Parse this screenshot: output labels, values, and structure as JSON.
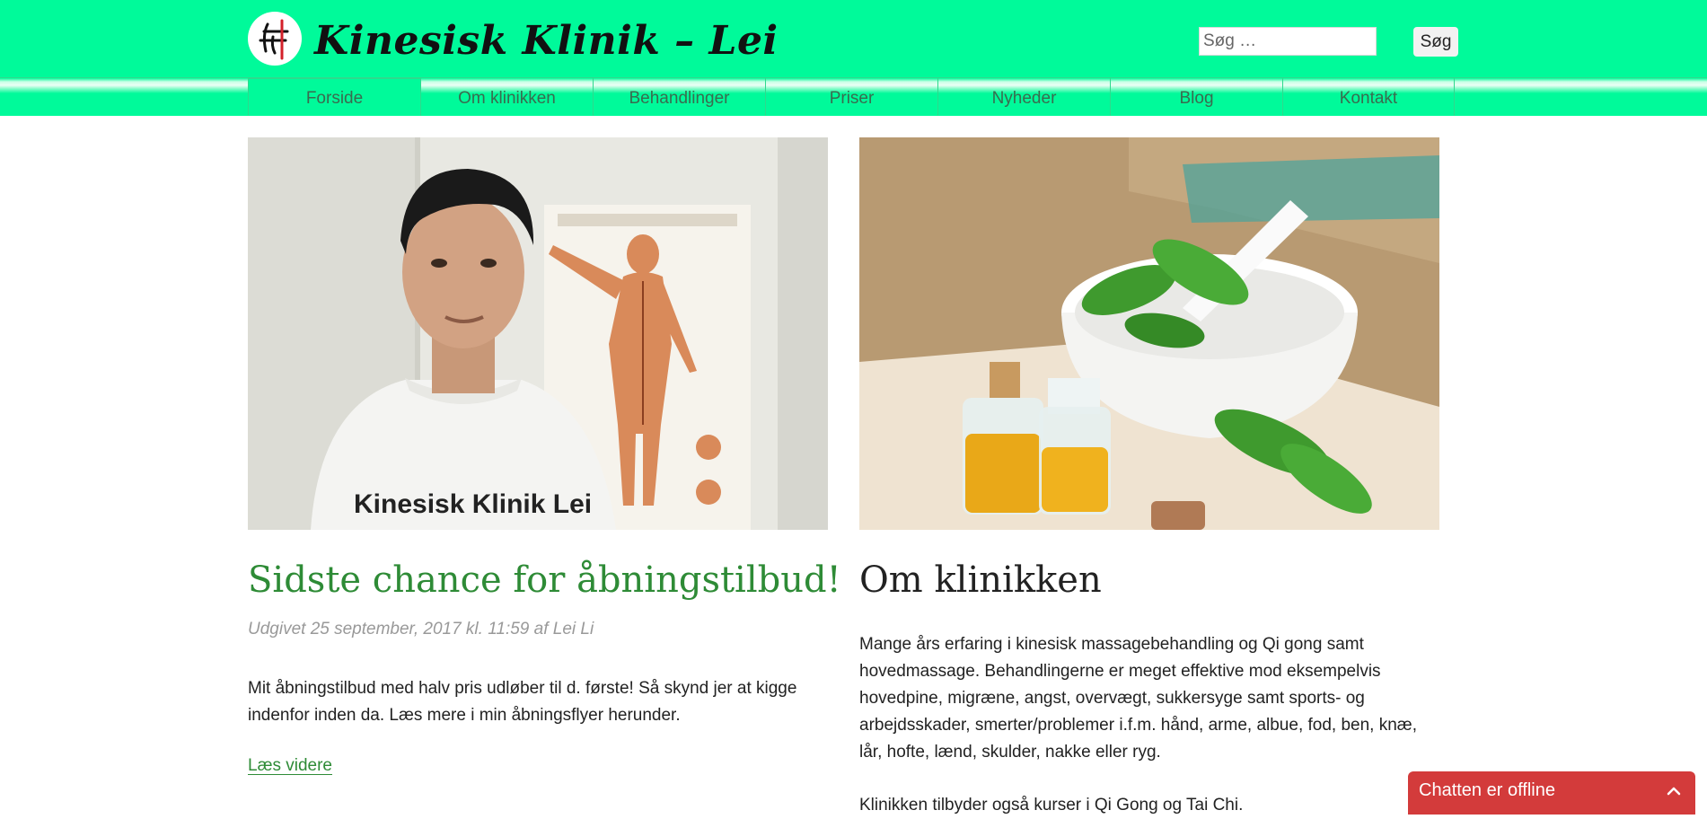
{
  "site": {
    "title": "Kinesisk Klinik – Lei",
    "logo_icon": "acupuncture-needle-logo-icon",
    "brand_color": "#00fa9a"
  },
  "search": {
    "placeholder": "Søg …",
    "button_label": "Søg"
  },
  "nav": {
    "items": [
      {
        "label": "Forside",
        "active": true
      },
      {
        "label": "Om klinikken"
      },
      {
        "label": "Behandlinger"
      },
      {
        "label": "Priser"
      },
      {
        "label": "Nyheder"
      },
      {
        "label": "Blog"
      },
      {
        "label": "Kontakt"
      }
    ]
  },
  "post": {
    "image_alt": "Man in Kinesisk Klinik Lei t-shirt beside acupuncture chart",
    "shirt_text": "Kinesisk Klinik Lei",
    "title": "Sidste chance for åbningstilbud!",
    "meta": "Udgivet 25 september, 2017 kl. 11:59 af Lei Li",
    "text": "Mit åbningstilbud med halv pris udløber til d. første! Så skynd jer at kigge indenfor inden da. Læs mere i min åbningsflyer herunder.",
    "read_more": "Læs videre",
    "link_color": "#2e8b36"
  },
  "about": {
    "image_alt": "Mortar with basil leaves and oil bottles",
    "title": "Om klinikken",
    "text": "Mange års erfaring i kinesisk massagebehandling og Qi gong samt hovedmassage. Behandlingerne er meget effektive mod eksempelvis hovedpine, migræne, angst, overvægt, sukkersyge samt sports- og arbejdsskader, smerter/problemer i.f.m. hånd, arme, albue, fod, ben, knæ, lår, hofte, lænd, skulder, nakke eller ryg.",
    "text2": "Klinikken tilbyder også kurser i Qi Gong og Tai Chi."
  },
  "chat": {
    "label": "Chatten er offline",
    "color": "#d33b3b",
    "icon": "chevron-up-icon"
  }
}
